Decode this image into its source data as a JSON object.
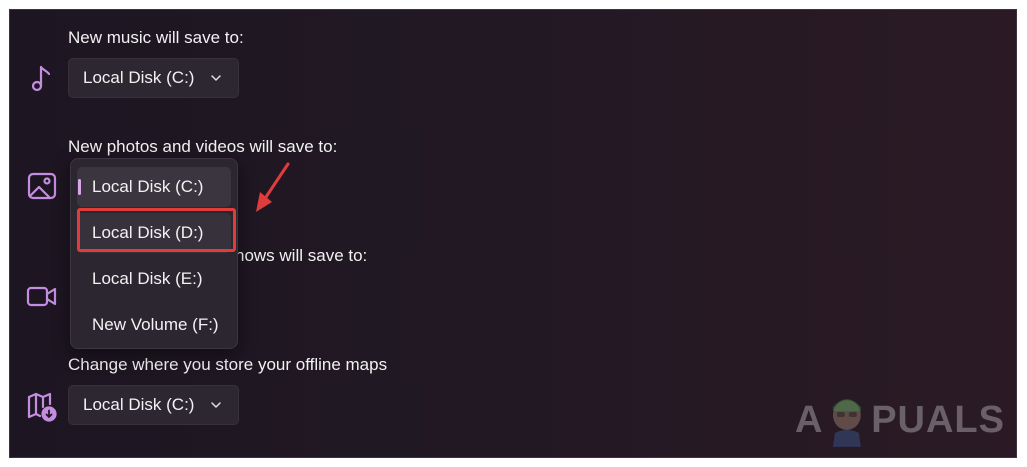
{
  "music": {
    "label": "New music will save to:",
    "value": "Local Disk (C:)",
    "icon": "music-note-icon"
  },
  "photos": {
    "label": "New photos and videos will save to:",
    "icon": "image-icon",
    "dropdown": {
      "options": [
        "Local Disk (C:)",
        "Local Disk (D:)",
        "Local Disk (E:)",
        "New Volume (F:)"
      ],
      "selected_index": 0,
      "highlighted_index": 1
    }
  },
  "movies": {
    "label_visible_part": "hows will save to:",
    "icon": "video-camera-icon"
  },
  "maps": {
    "label": "Change where you store your offline maps",
    "value": "Local Disk (C:)",
    "icon": "map-download-icon"
  },
  "annotation": {
    "highlight_color": "#e03c3c",
    "arrow_color": "#e03c3c"
  },
  "watermark": {
    "text_left": "A",
    "text_right": "PUALS"
  },
  "colors": {
    "accent_icon": "#c58de0",
    "selection_indicator": "#d9a6ea",
    "background": "#211823"
  }
}
